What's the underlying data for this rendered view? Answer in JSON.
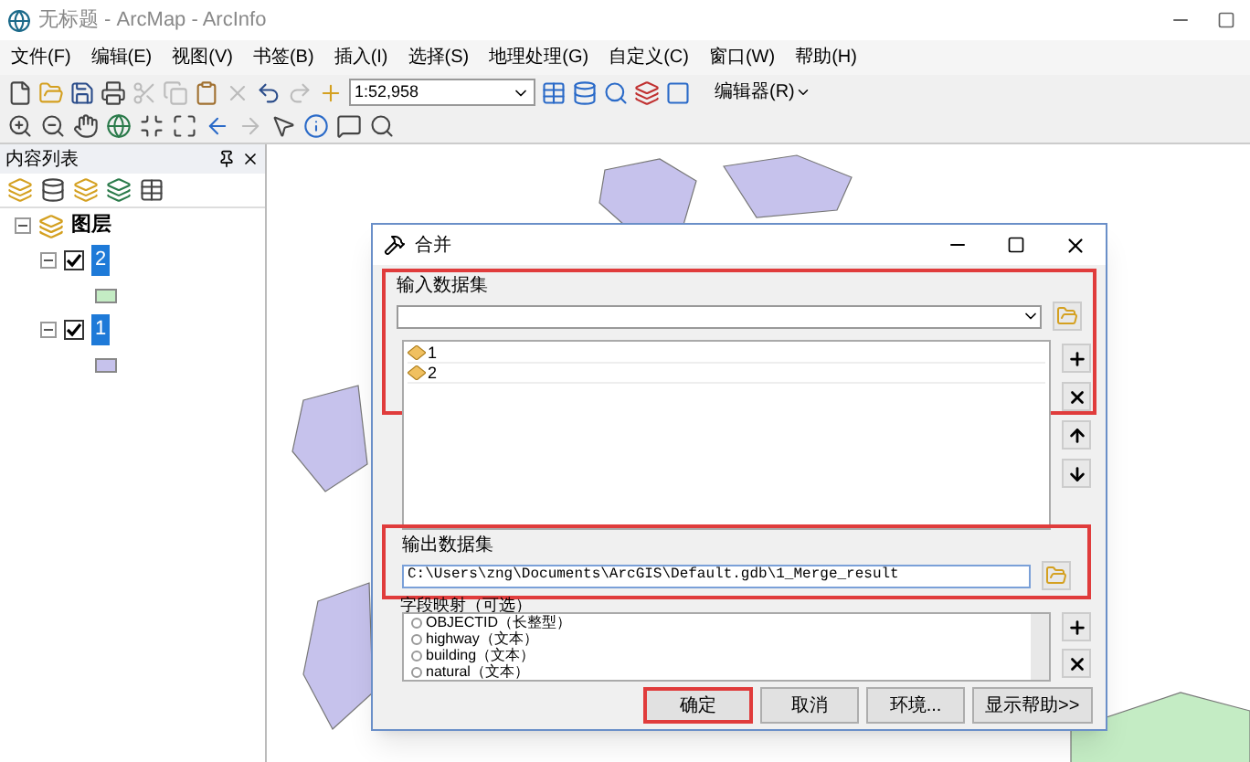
{
  "window": {
    "title": "无标题 - ArcMap - ArcInfo"
  },
  "menu": [
    "文件(F)",
    "编辑(E)",
    "视图(V)",
    "书签(B)",
    "插入(I)",
    "选择(S)",
    "地理处理(G)",
    "自定义(C)",
    "窗口(W)",
    "帮助(H)"
  ],
  "toolbar": {
    "scale": "1:52,958",
    "editor": "编辑器(R)"
  },
  "toc": {
    "title": "内容列表",
    "root": {
      "label": "图层",
      "expanded": true,
      "children": [
        {
          "label": "2",
          "checked": true,
          "expanded": true,
          "color": "#c4ecc4"
        },
        {
          "label": "1",
          "checked": true,
          "expanded": true,
          "color": "#c6c2ec"
        }
      ]
    }
  },
  "dialog": {
    "title": "合并",
    "input_label": "输入数据集",
    "input_highlighted": true,
    "inputs": [
      "1",
      "2"
    ],
    "output_label": "输出数据集",
    "output_value": "C:\\Users\\zng\\Documents\\ArcGIS\\Default.gdb\\1_Merge_result",
    "output_highlighted": true,
    "field_map_label": "字段映射（可选）",
    "fields": [
      "OBJECTID（长整型）",
      "highway（文本）",
      "building（文本）",
      "natural（文本）"
    ],
    "buttons": [
      {
        "label": "确定",
        "highlighted": true
      },
      {
        "label": "取消",
        "highlighted": false
      },
      {
        "label": "环境...",
        "highlighted": false
      },
      {
        "label": "显示帮助>>",
        "highlighted": false
      }
    ]
  }
}
